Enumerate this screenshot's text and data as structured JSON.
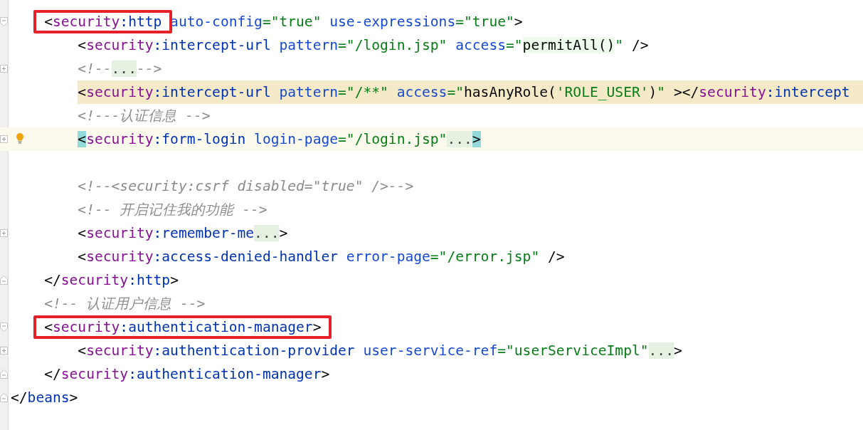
{
  "tree": [
    {
      "current": false,
      "highlighted": false,
      "bulb": false,
      "annotated": true,
      "collapsed": false,
      "tokens": [
        {
          "kind": "punct",
          "text": "<"
        },
        {
          "kind": "ns",
          "text": "security"
        },
        {
          "kind": "tag",
          "text": ":http"
        },
        {
          "kind": "attr",
          "text": " auto-config"
        },
        {
          "kind": "str",
          "text": "=\"true\""
        },
        {
          "kind": "attr",
          "text": " use-expressions"
        },
        {
          "kind": "str",
          "text": "=\"true\""
        },
        {
          "kind": "punct",
          "text": ">"
        }
      ],
      "children": [
        {
          "current": false,
          "highlighted": false,
          "bulb": false,
          "annotated": false,
          "collapsed": false,
          "tokens": [
            {
              "kind": "punct",
              "text": "<"
            },
            {
              "kind": "ns",
              "text": "security"
            },
            {
              "kind": "tag",
              "text": ":intercept-url"
            },
            {
              "kind": "attr",
              "text": " pattern"
            },
            {
              "kind": "str",
              "text": "=\"/login.jsp\""
            },
            {
              "kind": "attr",
              "text": " access"
            },
            {
              "kind": "str",
              "text": "=\""
            },
            {
              "kind": "injected",
              "text": "permitAll()"
            },
            {
              "kind": "str",
              "text": "\""
            },
            {
              "kind": "punct",
              "text": " />"
            }
          ]
        },
        {
          "current": false,
          "highlighted": false,
          "bulb": false,
          "annotated": false,
          "collapsed": true,
          "tokens": [
            {
              "kind": "comment",
              "text": "<!--"
            },
            {
              "kind": "folded",
              "text": "..."
            },
            {
              "kind": "comment",
              "text": "-->"
            }
          ]
        },
        {
          "current": false,
          "highlighted": true,
          "bulb": false,
          "annotated": false,
          "collapsed": false,
          "tokens": [
            {
              "kind": "punct",
              "text": "<"
            },
            {
              "kind": "ns",
              "text": "security"
            },
            {
              "kind": "tag",
              "text": ":intercept-url"
            },
            {
              "kind": "attr",
              "text": " pattern"
            },
            {
              "kind": "str",
              "text": "=\"/**\""
            },
            {
              "kind": "attr",
              "text": " access"
            },
            {
              "kind": "str",
              "text": "=\""
            },
            {
              "kind": "plain",
              "text": "hasAnyRole("
            },
            {
              "kind": "str",
              "text": "'ROLE_USER'"
            },
            {
              "kind": "plain",
              "text": ")"
            },
            {
              "kind": "str",
              "text": "\""
            },
            {
              "kind": "punct",
              "text": " ></"
            },
            {
              "kind": "ns",
              "text": "security"
            },
            {
              "kind": "tag",
              "text": ":intercept"
            }
          ]
        },
        {
          "current": false,
          "highlighted": false,
          "bulb": false,
          "annotated": false,
          "collapsed": false,
          "tokens": [
            {
              "kind": "comment",
              "text": "<!---认证信息 -->"
            }
          ]
        },
        {
          "current": true,
          "highlighted": false,
          "bulb": true,
          "annotated": false,
          "collapsed": true,
          "tokens": [
            {
              "kind": "match",
              "text": "<"
            },
            {
              "kind": "ns",
              "text": "security"
            },
            {
              "kind": "tag",
              "text": ":form-login"
            },
            {
              "kind": "attr",
              "text": " login-page"
            },
            {
              "kind": "str",
              "text": "=\"/login.jsp\""
            },
            {
              "kind": "folded",
              "text": "..."
            },
            {
              "kind": "match",
              "text": ">"
            }
          ]
        },
        {
          "current": false,
          "highlighted": false,
          "bulb": false,
          "annotated": false,
          "collapsed": false
        },
        {
          "current": false,
          "highlighted": false,
          "bulb": false,
          "annotated": false,
          "collapsed": false,
          "tokens": [
            {
              "kind": "comment",
              "text": "<!--<security:csrf disabled=\"true\" />-->"
            }
          ]
        },
        {
          "current": false,
          "highlighted": false,
          "bulb": false,
          "annotated": false,
          "collapsed": false,
          "tokens": [
            {
              "kind": "comment",
              "text": "<!-- 开启记住我的功能 -->"
            }
          ]
        },
        {
          "current": false,
          "highlighted": false,
          "bulb": false,
          "annotated": false,
          "collapsed": true,
          "tokens": [
            {
              "kind": "punct",
              "text": "<"
            },
            {
              "kind": "ns",
              "text": "security"
            },
            {
              "kind": "tag",
              "text": ":remember-me"
            },
            {
              "kind": "folded",
              "text": "..."
            },
            {
              "kind": "punct",
              "text": ">"
            }
          ]
        },
        {
          "current": false,
          "highlighted": false,
          "bulb": false,
          "annotated": false,
          "collapsed": false,
          "tokens": [
            {
              "kind": "punct",
              "text": "<"
            },
            {
              "kind": "ns",
              "text": "security"
            },
            {
              "kind": "tag",
              "text": ":access-denied-handler"
            },
            {
              "kind": "attr",
              "text": " error-page"
            },
            {
              "kind": "str",
              "text": "=\"/error.jsp\""
            },
            {
              "kind": "punct",
              "text": " />"
            }
          ]
        }
      ],
      "closing": {
        "tokens": [
          {
            "kind": "punct",
            "text": "</"
          },
          {
            "kind": "ns",
            "text": "security"
          },
          {
            "kind": "tag",
            "text": ":http"
          },
          {
            "kind": "punct",
            "text": ">"
          }
        ]
      }
    },
    {
      "current": false,
      "highlighted": false,
      "bulb": false,
      "annotated": false,
      "collapsed": false,
      "tokens": [
        {
          "kind": "comment",
          "text": "<!-- 认证用户信息 -->"
        }
      ]
    },
    {
      "current": false,
      "highlighted": false,
      "bulb": false,
      "annotated": true,
      "collapsed": false,
      "tokens": [
        {
          "kind": "punct",
          "text": "<"
        },
        {
          "kind": "ns",
          "text": "security"
        },
        {
          "kind": "tag",
          "text": ":authentication-manager"
        },
        {
          "kind": "punct",
          "text": ">"
        }
      ],
      "children": [
        {
          "current": false,
          "highlighted": false,
          "bulb": false,
          "annotated": false,
          "collapsed": true,
          "tokens": [
            {
              "kind": "punct",
              "text": "<"
            },
            {
              "kind": "ns",
              "text": "security"
            },
            {
              "kind": "tag",
              "text": ":authentication-provider"
            },
            {
              "kind": "attr",
              "text": " user-service-ref"
            },
            {
              "kind": "str",
              "text": "=\"userServiceImpl\""
            },
            {
              "kind": "folded",
              "text": "..."
            },
            {
              "kind": "punct",
              "text": ">"
            }
          ]
        }
      ],
      "closing": {
        "tokens": [
          {
            "kind": "punct",
            "text": "</"
          },
          {
            "kind": "ns",
            "text": "security"
          },
          {
            "kind": "tag",
            "text": ":authentication-manager"
          },
          {
            "kind": "punct",
            "text": ">"
          }
        ]
      }
    }
  ],
  "end_line": {
    "tokens": [
      {
        "kind": "punct",
        "text": "</"
      },
      {
        "kind": "tag",
        "text": "beans"
      },
      {
        "kind": "punct",
        "text": ">"
      }
    ]
  }
}
